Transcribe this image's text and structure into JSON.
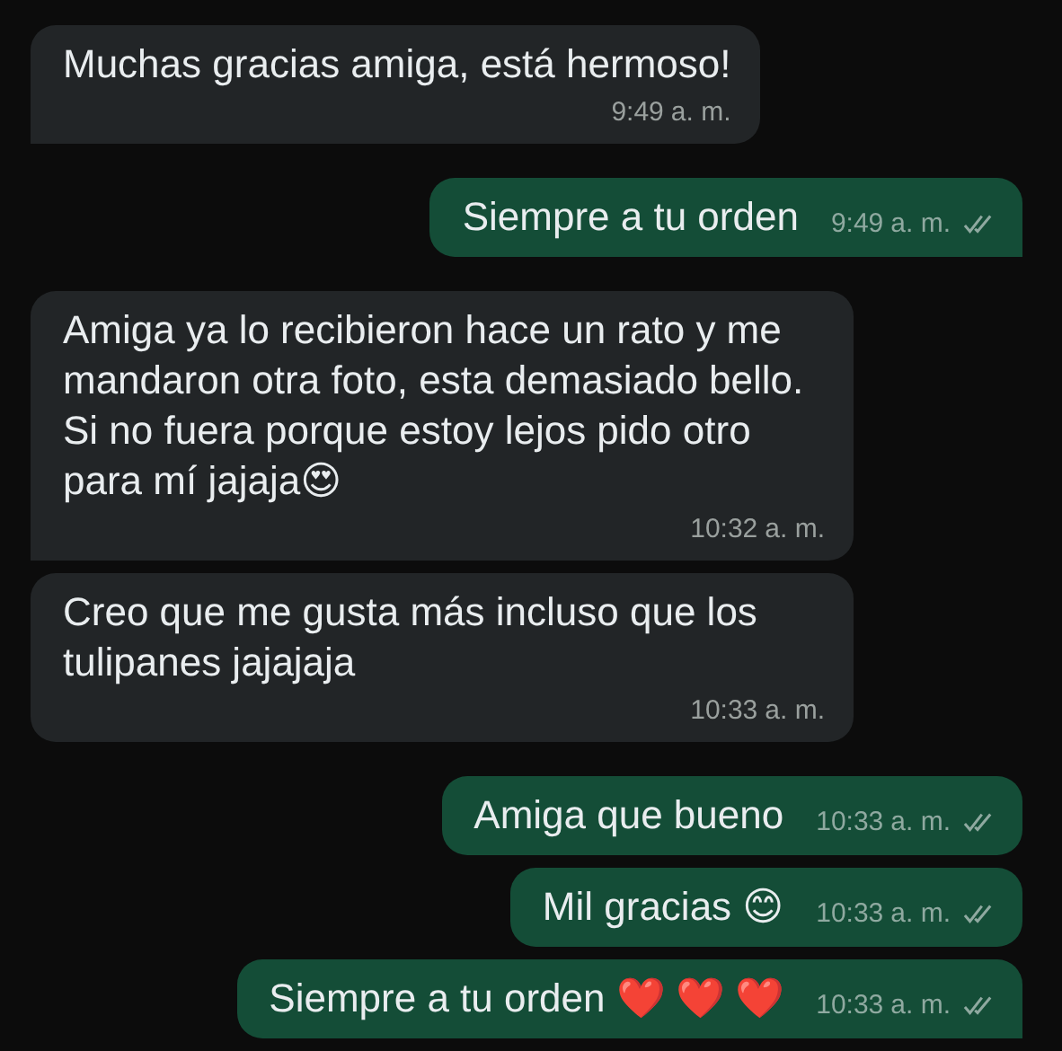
{
  "messages": [
    {
      "kind": "incoming",
      "tail": true,
      "text": "Muchas gracias amiga, está hermoso!",
      "time": "9:49",
      "period": "a. m."
    },
    {
      "kind": "outgoing",
      "tail": true,
      "text": "Siempre a tu orden",
      "time": "9:49",
      "period": "a. m.",
      "read": true
    },
    {
      "kind": "incoming",
      "tail": true,
      "text": "Amiga ya lo recibieron hace un rato y me mandaron otra foto, esta demasiado bello. Si no fuera porque estoy lejos pido otro para mí jajaja😍",
      "time": "10:32",
      "period": "a. m."
    },
    {
      "kind": "incoming",
      "tail": false,
      "text": "Creo que me gusta más incluso que los tulipanes jajajaja",
      "time": "10:33",
      "period": "a. m."
    },
    {
      "kind": "outgoing",
      "tail": false,
      "text": "Amiga que bueno",
      "time": "10:33",
      "period": "a. m.",
      "read": true
    },
    {
      "kind": "outgoing",
      "tail": false,
      "text": "Mil gracias 😊",
      "time": "10:33",
      "period": "a. m.",
      "read": true
    },
    {
      "kind": "outgoing",
      "tail": true,
      "text": "Siempre a tu orden ❤️ ❤️ ❤️",
      "time": "10:33",
      "period": "a. m.",
      "read": true
    }
  ]
}
